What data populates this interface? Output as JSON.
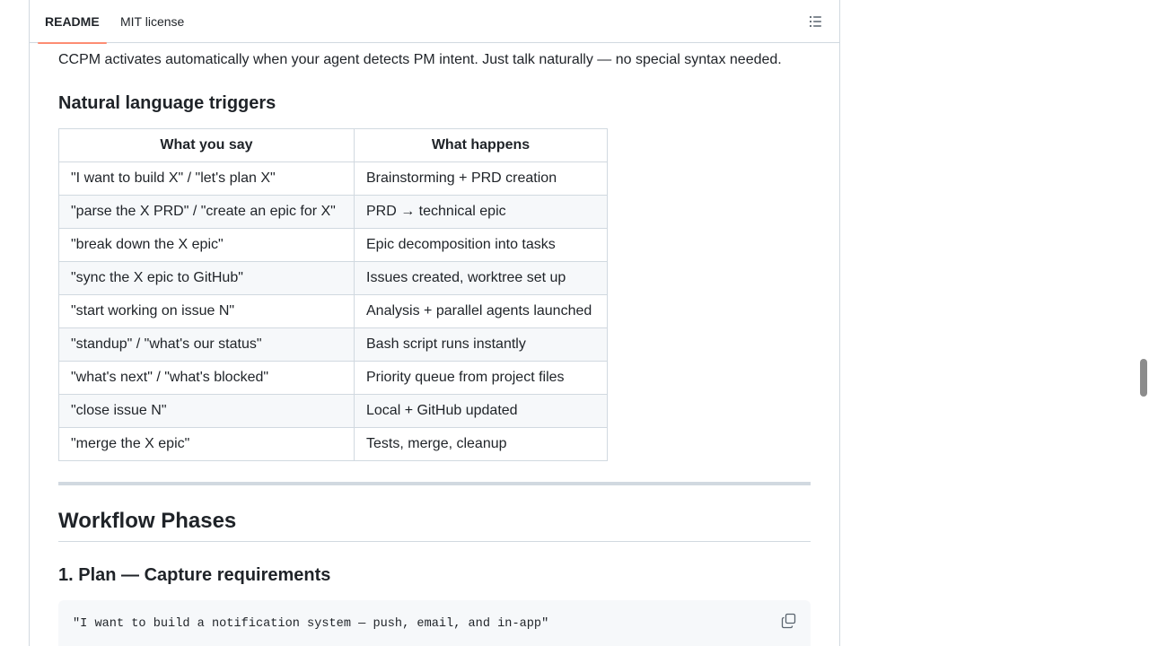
{
  "tabs": [
    {
      "label": "README",
      "active": true
    },
    {
      "label": "MIT license",
      "active": false
    }
  ],
  "outline_icon": "list-unordered-icon",
  "intro_text": "CCPM activates automatically when your agent detects PM intent. Just talk naturally — no special syntax needed.",
  "triggers_section": {
    "heading": "Natural language triggers",
    "columns": [
      "What you say",
      "What happens"
    ],
    "rows": [
      [
        "\"I want to build X\" / \"let's plan X\"",
        "Brainstorming + PRD creation"
      ],
      [
        "\"parse the X PRD\" / \"create an epic for X\"",
        "PRD → technical epic"
      ],
      [
        "\"break down the X epic\"",
        "Epic decomposition into tasks"
      ],
      [
        "\"sync the X epic to GitHub\"",
        "Issues created, worktree set up"
      ],
      [
        "\"start working on issue N\"",
        "Analysis + parallel agents launched"
      ],
      [
        "\"standup\" / \"what's our status\"",
        "Bash script runs instantly"
      ],
      [
        "\"what's next\" / \"what's blocked\"",
        "Priority queue from project files"
      ],
      [
        "\"close issue N\"",
        "Local + GitHub updated"
      ],
      [
        "\"merge the X epic\"",
        "Tests, merge, cleanup"
      ]
    ]
  },
  "workflow_heading": "Workflow Phases",
  "plan_heading": "1. Plan — Capture requirements",
  "code_example": "\"I want to build a notification system — push, email, and in-app\"",
  "copy_icon": "copy-icon",
  "colors": {
    "tab_underline": "#fd8c73",
    "border": "#d1d9e0",
    "code_bg": "#f6f8fa",
    "text": "#1f2328"
  }
}
